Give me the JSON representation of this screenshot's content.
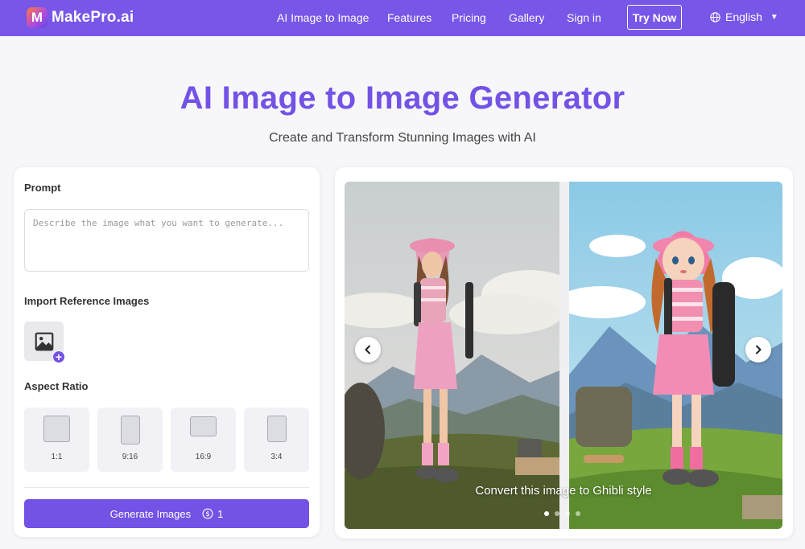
{
  "brand": {
    "logo_letter": "M",
    "name": "MakePro.ai"
  },
  "nav": {
    "links": [
      "AI Image to Image",
      "Features",
      "Pricing",
      "Gallery",
      "Sign in"
    ],
    "cta": "Try Now",
    "language": "English"
  },
  "hero": {
    "title": "AI Image to Image Generator",
    "subtitle": "Create and Transform Stunning Images with AI"
  },
  "form": {
    "prompt_label": "Prompt",
    "prompt_placeholder": "Describe the image what you want to generate...",
    "prompt_value": "",
    "reference_label": "Import Reference Images",
    "aspect_label": "Aspect Ratio",
    "aspect_ratios": [
      "1:1",
      "9:16",
      "16:9",
      "3:4"
    ],
    "generate_label": "Generate Images",
    "credit_cost": "1"
  },
  "gallery": {
    "caption": "Convert this image to Ghibli style",
    "slide_count": 4,
    "active_slide": 0
  },
  "colors": {
    "brand": "#7756e8",
    "accent": "#7352e6"
  },
  "icons": {
    "globe": "globe-icon",
    "image": "image-icon",
    "coin": "coin-icon",
    "prev": "chevron-left-icon",
    "next": "chevron-right-icon"
  }
}
